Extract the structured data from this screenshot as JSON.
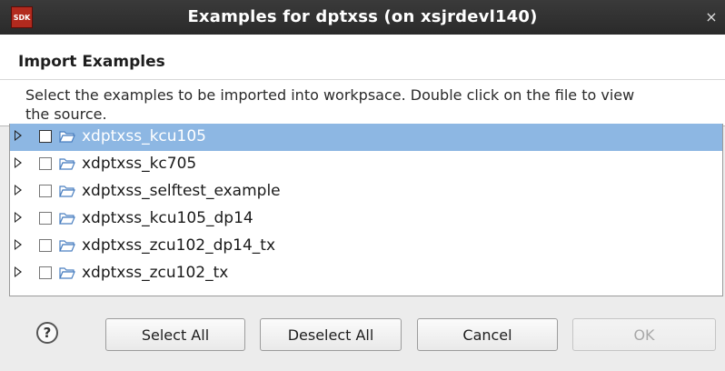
{
  "window": {
    "title": "Examples for dptxss  (on xsjrdevl140)",
    "app_icon_text": "SDK",
    "close_glyph": "×"
  },
  "header": {
    "title": "Import Examples",
    "description": "Select the examples to be imported into workpsace. Double click on the file to view the source."
  },
  "tree": {
    "items": [
      {
        "label": "xdptxss_kcu105",
        "checked": false,
        "selected": true
      },
      {
        "label": "xdptxss_kc705",
        "checked": false,
        "selected": false
      },
      {
        "label": "xdptxss_selftest_example",
        "checked": false,
        "selected": false
      },
      {
        "label": "xdptxss_kcu105_dp14",
        "checked": false,
        "selected": false
      },
      {
        "label": "xdptxss_zcu102_dp14_tx",
        "checked": false,
        "selected": false
      },
      {
        "label": "xdptxss_zcu102_tx",
        "checked": false,
        "selected": false
      }
    ]
  },
  "buttons": {
    "help": "?",
    "select_all": "Select All",
    "deselect_all": "Deselect All",
    "cancel": "Cancel",
    "ok": "OK"
  },
  "colors": {
    "titlebar": "#2e2e2e",
    "selection": "#8db7e3",
    "folder": "#5b8fcf",
    "app_icon": "#b22a1e"
  }
}
